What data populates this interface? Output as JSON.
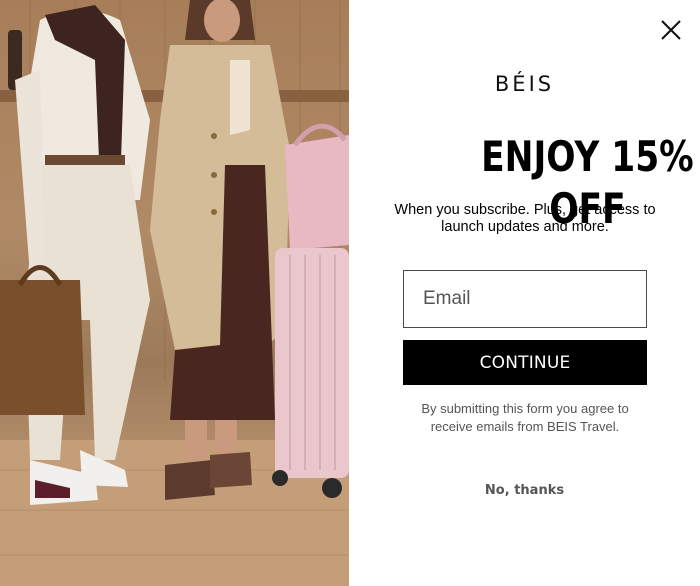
{
  "popup": {
    "brand": "BÉIS",
    "headline": "ENJOY 15% OFF",
    "subtext": "When you subscribe. Plus, get access to launch updates and more.",
    "email_placeholder": "Email",
    "continue_label": "CONTINUE",
    "disclaimer": "By submitting this form you agree to receive emails from BEIS Travel.",
    "no_thanks_label": "No, thanks"
  },
  "icons": {
    "close": "close-icon"
  },
  "colors": {
    "button_bg": "#000000",
    "button_text": "#ffffff",
    "secondary_text": "#555555",
    "suitcase_pink": "#e9c7cc"
  }
}
